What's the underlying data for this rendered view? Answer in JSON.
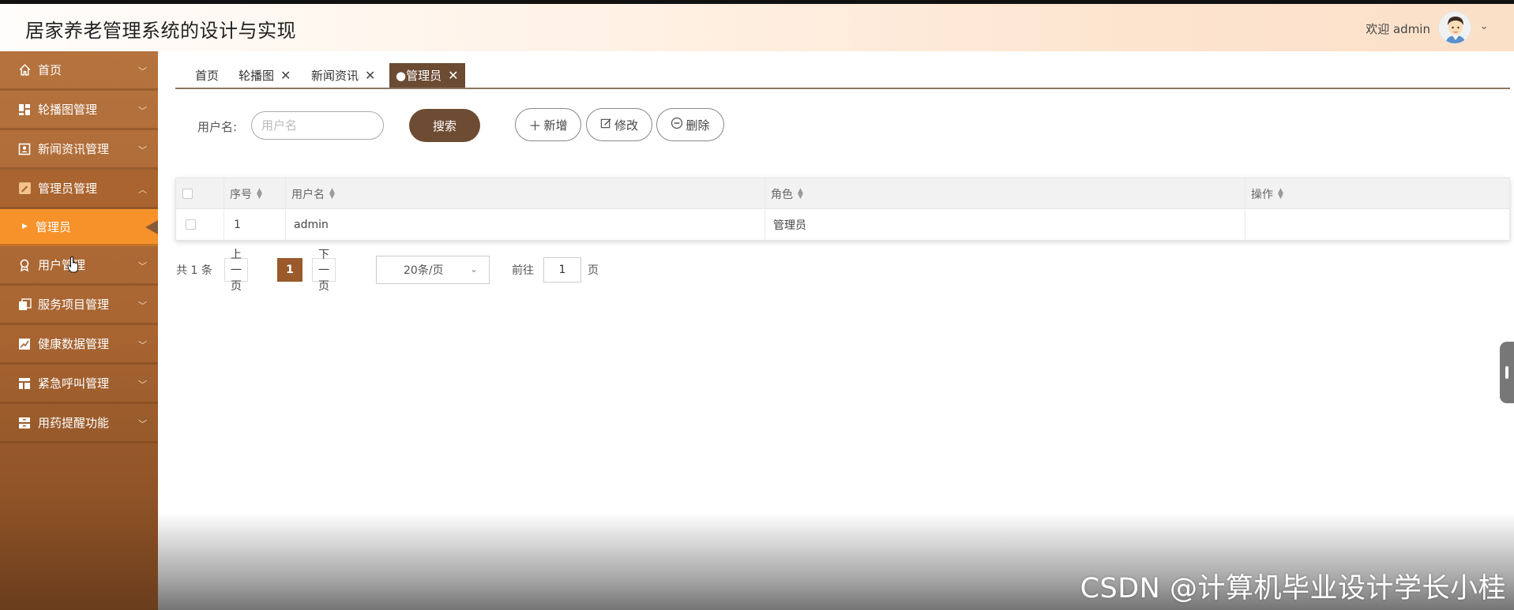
{
  "header": {
    "title": "居家养老管理系统的设计与实现",
    "welcome": "欢迎 admin",
    "accent": "#fde4cf"
  },
  "sidebar": {
    "items": [
      {
        "label": "首页",
        "icon": "home-icon"
      },
      {
        "label": "轮播图管理",
        "icon": "dashboard-icon"
      },
      {
        "label": "新闻资讯管理",
        "icon": "contact-card-icon"
      },
      {
        "label": "管理员管理",
        "icon": "edit-square-icon",
        "expanded": true
      },
      {
        "label": "用户管理",
        "icon": "award-icon"
      },
      {
        "label": "服务项目管理",
        "icon": "copy-icon"
      },
      {
        "label": "健康数据管理",
        "icon": "chart-square-icon"
      },
      {
        "label": "紧急呼叫管理",
        "icon": "layout-icon"
      },
      {
        "label": "用药提醒功能",
        "icon": "cabinet-icon"
      }
    ],
    "sub_items": [
      {
        "label": "管理员",
        "active": true
      }
    ],
    "colors": {
      "bg": "#a86532",
      "active_sub": "#f7922b"
    }
  },
  "tabs": [
    {
      "label": "首页",
      "closable": false
    },
    {
      "label": "轮播图",
      "closable": true
    },
    {
      "label": "新闻资讯",
      "closable": true
    },
    {
      "label": "●管理员",
      "closable": true,
      "active": true
    }
  ],
  "search": {
    "label": "用户名:",
    "placeholder": "用户名",
    "value": "",
    "button": "搜索"
  },
  "actions": {
    "add": "新增",
    "edit": "修改",
    "delete": "删除"
  },
  "table": {
    "columns": [
      "序号",
      "用户名",
      "角色",
      "操作"
    ],
    "rows": [
      {
        "index": "1",
        "username": "admin",
        "role": "管理员",
        "ops": ""
      }
    ]
  },
  "pager": {
    "total": "共 1 条",
    "prev": "上一页",
    "current": "1",
    "next": "下一页",
    "page_size": "20条/页",
    "goto_label": "前往",
    "goto_value": "1",
    "page_unit": "页"
  },
  "watermark": "CSDN @计算机毕业设计学长小桂"
}
